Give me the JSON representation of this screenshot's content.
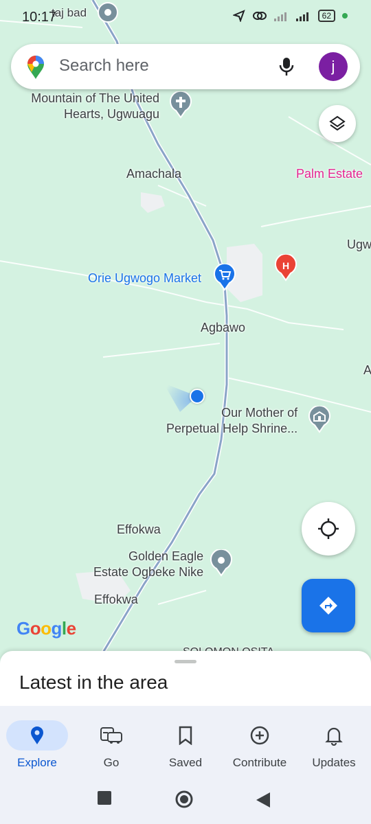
{
  "status_bar": {
    "time": "10:17",
    "battery": "62"
  },
  "search": {
    "placeholder": "Search here",
    "avatar_letter": "j"
  },
  "map_labels": {
    "top_place": "taj bad",
    "mountain_1": "Mountain of The United",
    "mountain_2": "Hearts, Ugwuagu",
    "amachala": "Amachala",
    "palm_estate": "Palm Estate",
    "ugw": "Ugw",
    "market": "Orie Ugwogo Market",
    "agbawo": "Agbawo",
    "a_edge": "A",
    "shrine_1": "Our Mother of",
    "shrine_2": "Perpetual Help Shrine...",
    "effokwa_1": "Effokwa",
    "golden_1": "Golden Eagle",
    "golden_2": "Estate Ogbeke Nike",
    "effokwa_2": "Effokwa",
    "solomon": "SOLOMON OSITA"
  },
  "google_logo": [
    "G",
    "o",
    "o",
    "g",
    "l",
    "e"
  ],
  "sheet": {
    "title": "Latest in the area"
  },
  "nav": [
    {
      "label": "Explore",
      "icon": "location-pin-icon"
    },
    {
      "label": "Go",
      "icon": "commute-icon"
    },
    {
      "label": "Saved",
      "icon": "bookmark-icon"
    },
    {
      "label": "Contribute",
      "icon": "add-circle-icon"
    },
    {
      "label": "Updates",
      "icon": "bell-icon"
    }
  ],
  "colors": {
    "map_bg": "#d4f2e1",
    "road": "#8aa4c8",
    "accent": "#1a73e8",
    "avatar": "#7b1fa2"
  }
}
